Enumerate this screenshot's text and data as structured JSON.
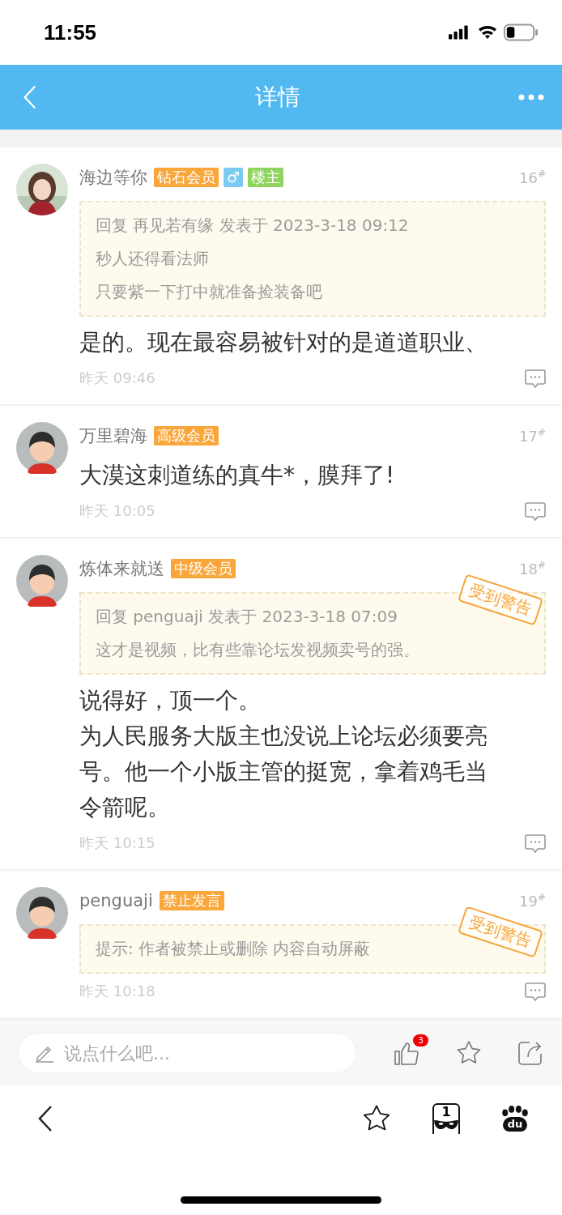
{
  "status_bar": {
    "time": "11:55"
  },
  "nav": {
    "title": "详情"
  },
  "posts": [
    {
      "author": "海边等你",
      "badges": [
        {
          "label": "钻石会员",
          "color": "#f9a63a"
        },
        {
          "label": "♂",
          "color": "#7ccaf2"
        },
        {
          "label": "楼主",
          "color": "#8fd45e"
        }
      ],
      "floor": "16$^{#}$",
      "warned": false,
      "quote": [
        "回复 再见若有缘 发表于 2023-3-18 09:12",
        "秒人还得看法师",
        "只要紫一下打中就准备捡装备吧"
      ],
      "body": [
        "是的。现在最容易被针对的是道道职业、"
      ],
      "time": "昨天 09:46"
    },
    {
      "author": "万里碧海",
      "badges": [
        {
          "label": "高级会员",
          "color": "#f9a63a"
        }
      ],
      "floor": "17$^{#}$",
      "warned": false,
      "body": [
        "大漠这刺道练的真牛*，膜拜了!"
      ],
      "time": "昨天 10:05"
    },
    {
      "author": "炼体来就送",
      "badges": [
        {
          "label": "中级会员",
          "color": "#f9a63a"
        }
      ],
      "floor": "18$^{#}$",
      "warned": true,
      "stamp": "受到警告",
      "quote": [
        "回复 penguaji 发表于 2023-3-18 07:09",
        "这才是视频，比有些靠论坛发视频卖号的强。"
      ],
      "body": [
        "说得好，顶一个。",
        "为人民服务大版主也没说上论坛必须要亮号。他一个小版主管的挺宽，拿着鸡毛当令箭呢。"
      ],
      "time": "昨天 10:15"
    },
    {
      "author": "penguaji",
      "badges": [
        {
          "label": "禁止发言",
          "color": "#f9a63a"
        }
      ],
      "floor": "19$^{#}$",
      "warned": true,
      "stamp": "受到警告",
      "quote": [
        "提示: 作者被禁止或删除 内容自动屏蔽"
      ],
      "time": "昨天 10:18"
    }
  ],
  "reply_bar": {
    "placeholder": "说点什么吧...",
    "like_count": "3"
  },
  "browser_bar": {
    "tabs_count": "1",
    "logo_text": "du"
  }
}
